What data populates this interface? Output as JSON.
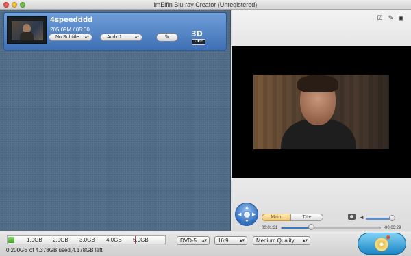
{
  "window": {
    "title": "imElfin Blu-ray Creator (Unregistered)"
  },
  "file_list": {
    "items": [
      {
        "name": "4speedddd",
        "size_duration": "205.09M / 05:00",
        "subtitle_select": "No Subtitle",
        "audio_select": "Audio1",
        "edit_icon": "edit-icon",
        "three_d_label": "3D",
        "three_d_state": "OFF"
      }
    ]
  },
  "preview": {
    "toolbar_icons": [
      "snapshot-icon",
      "edit-icon",
      "crop-icon"
    ],
    "menu_tabs": {
      "main": "Main",
      "title": "Title"
    },
    "current_time": "00:01:31",
    "remaining_time": "-00:03:29",
    "progress_fraction": 0.3,
    "volume_fraction": 0.9
  },
  "bottom_bar": {
    "capacity": {
      "ticks": [
        "1.0GB",
        "2.0GB",
        "3.0GB",
        "4.0GB",
        "5.0GB"
      ],
      "used_gb": 0.2,
      "max_gb": 5.4,
      "limit_gb": 4.378,
      "status": "0.200GB of 4.378GB used,4.178GB left"
    },
    "disc_type": "DVD-5",
    "aspect_ratio": "16:9",
    "quality": "Medium Quality",
    "burn_icon": "burn-disc-icon"
  },
  "colors": {
    "item_blue": "#3f70b4",
    "panel_bg": "#4f6b87",
    "capacity_green": "#3fa42a",
    "accent_blue": "#2f6dc0"
  }
}
